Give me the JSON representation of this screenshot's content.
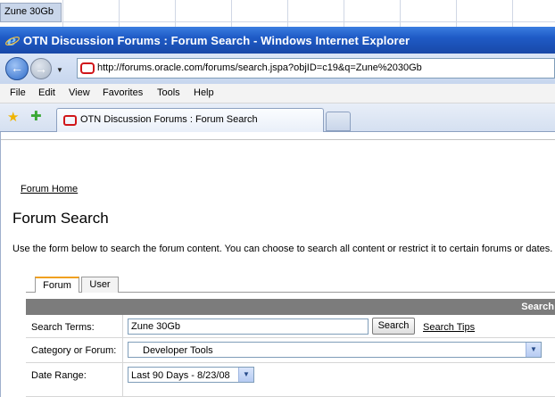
{
  "spreadsheet": {
    "selected_cell": "Zune 30Gb"
  },
  "window": {
    "title": "OTN Discussion Forums : Forum Search - Windows Internet Explorer"
  },
  "address": {
    "url": "http://forums.oracle.com/forums/search.jspa?objID=c19&q=Zune%2030Gb"
  },
  "menu": [
    "File",
    "Edit",
    "View",
    "Favorites",
    "Tools",
    "Help"
  ],
  "tab": {
    "title": "OTN Discussion Forums : Forum Search"
  },
  "page": {
    "forum_home": "Forum Home",
    "title": "Forum Search",
    "intro": "Use the form below to search the forum content. You can choose to search all content or restrict it to certain forums or dates.",
    "tabs": [
      "Forum",
      "User"
    ],
    "panel_header": "Search",
    "search_terms_label": "Search Terms:",
    "search_terms_value": "Zune 30Gb",
    "search_button": "Search",
    "search_tips": "Search Tips",
    "category_label": "Category or Forum:",
    "category_value": "Developer Tools",
    "date_label": "Date Range:",
    "date_value": "Last 90 Days - 8/23/08"
  }
}
